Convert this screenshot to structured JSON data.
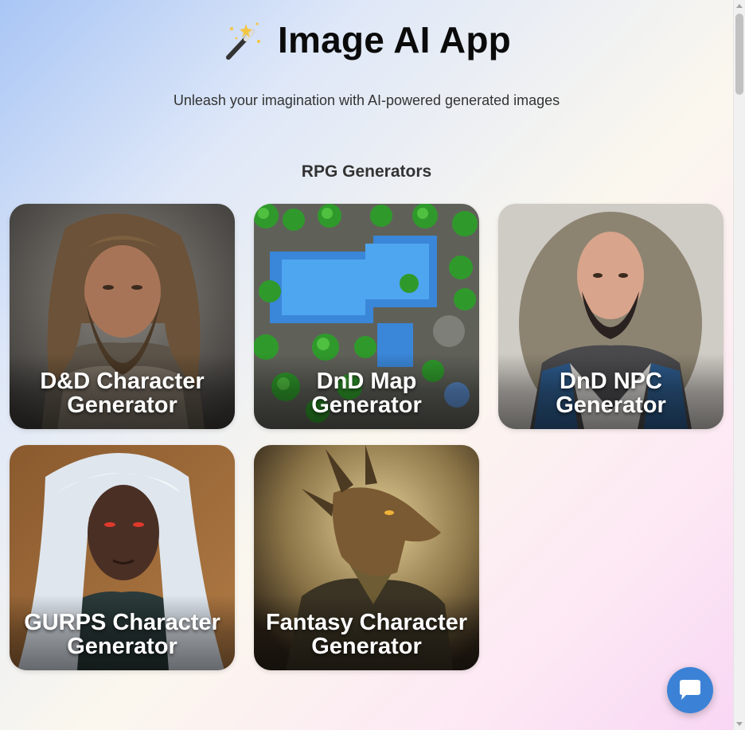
{
  "header": {
    "icon": "magic-wand-icon",
    "title": "Image AI App",
    "subtitle": "Unleash your imagination with AI-powered generated images"
  },
  "section": {
    "title": "RPG Generators"
  },
  "cards": [
    {
      "line1": "D&D Character",
      "line2": "Generator",
      "image": "bearded-warrior-portrait"
    },
    {
      "line1": "DnD Map",
      "line2": "Generator",
      "image": "fantasy-battle-map"
    },
    {
      "line1": "DnD NPC",
      "line2": "Generator",
      "image": "bald-bearded-npc-portrait"
    },
    {
      "line1": "GURPS Character",
      "line2": "Generator",
      "image": "white-haired-elf-portrait"
    },
    {
      "line1": "Fantasy Character",
      "line2": "Generator",
      "image": "dragon-warrior-portrait"
    }
  ],
  "chat": {
    "icon": "chat-bubble-icon"
  },
  "colors": {
    "accent": "#3b82d6",
    "title": "#0b0b0b",
    "text": "#333333"
  }
}
